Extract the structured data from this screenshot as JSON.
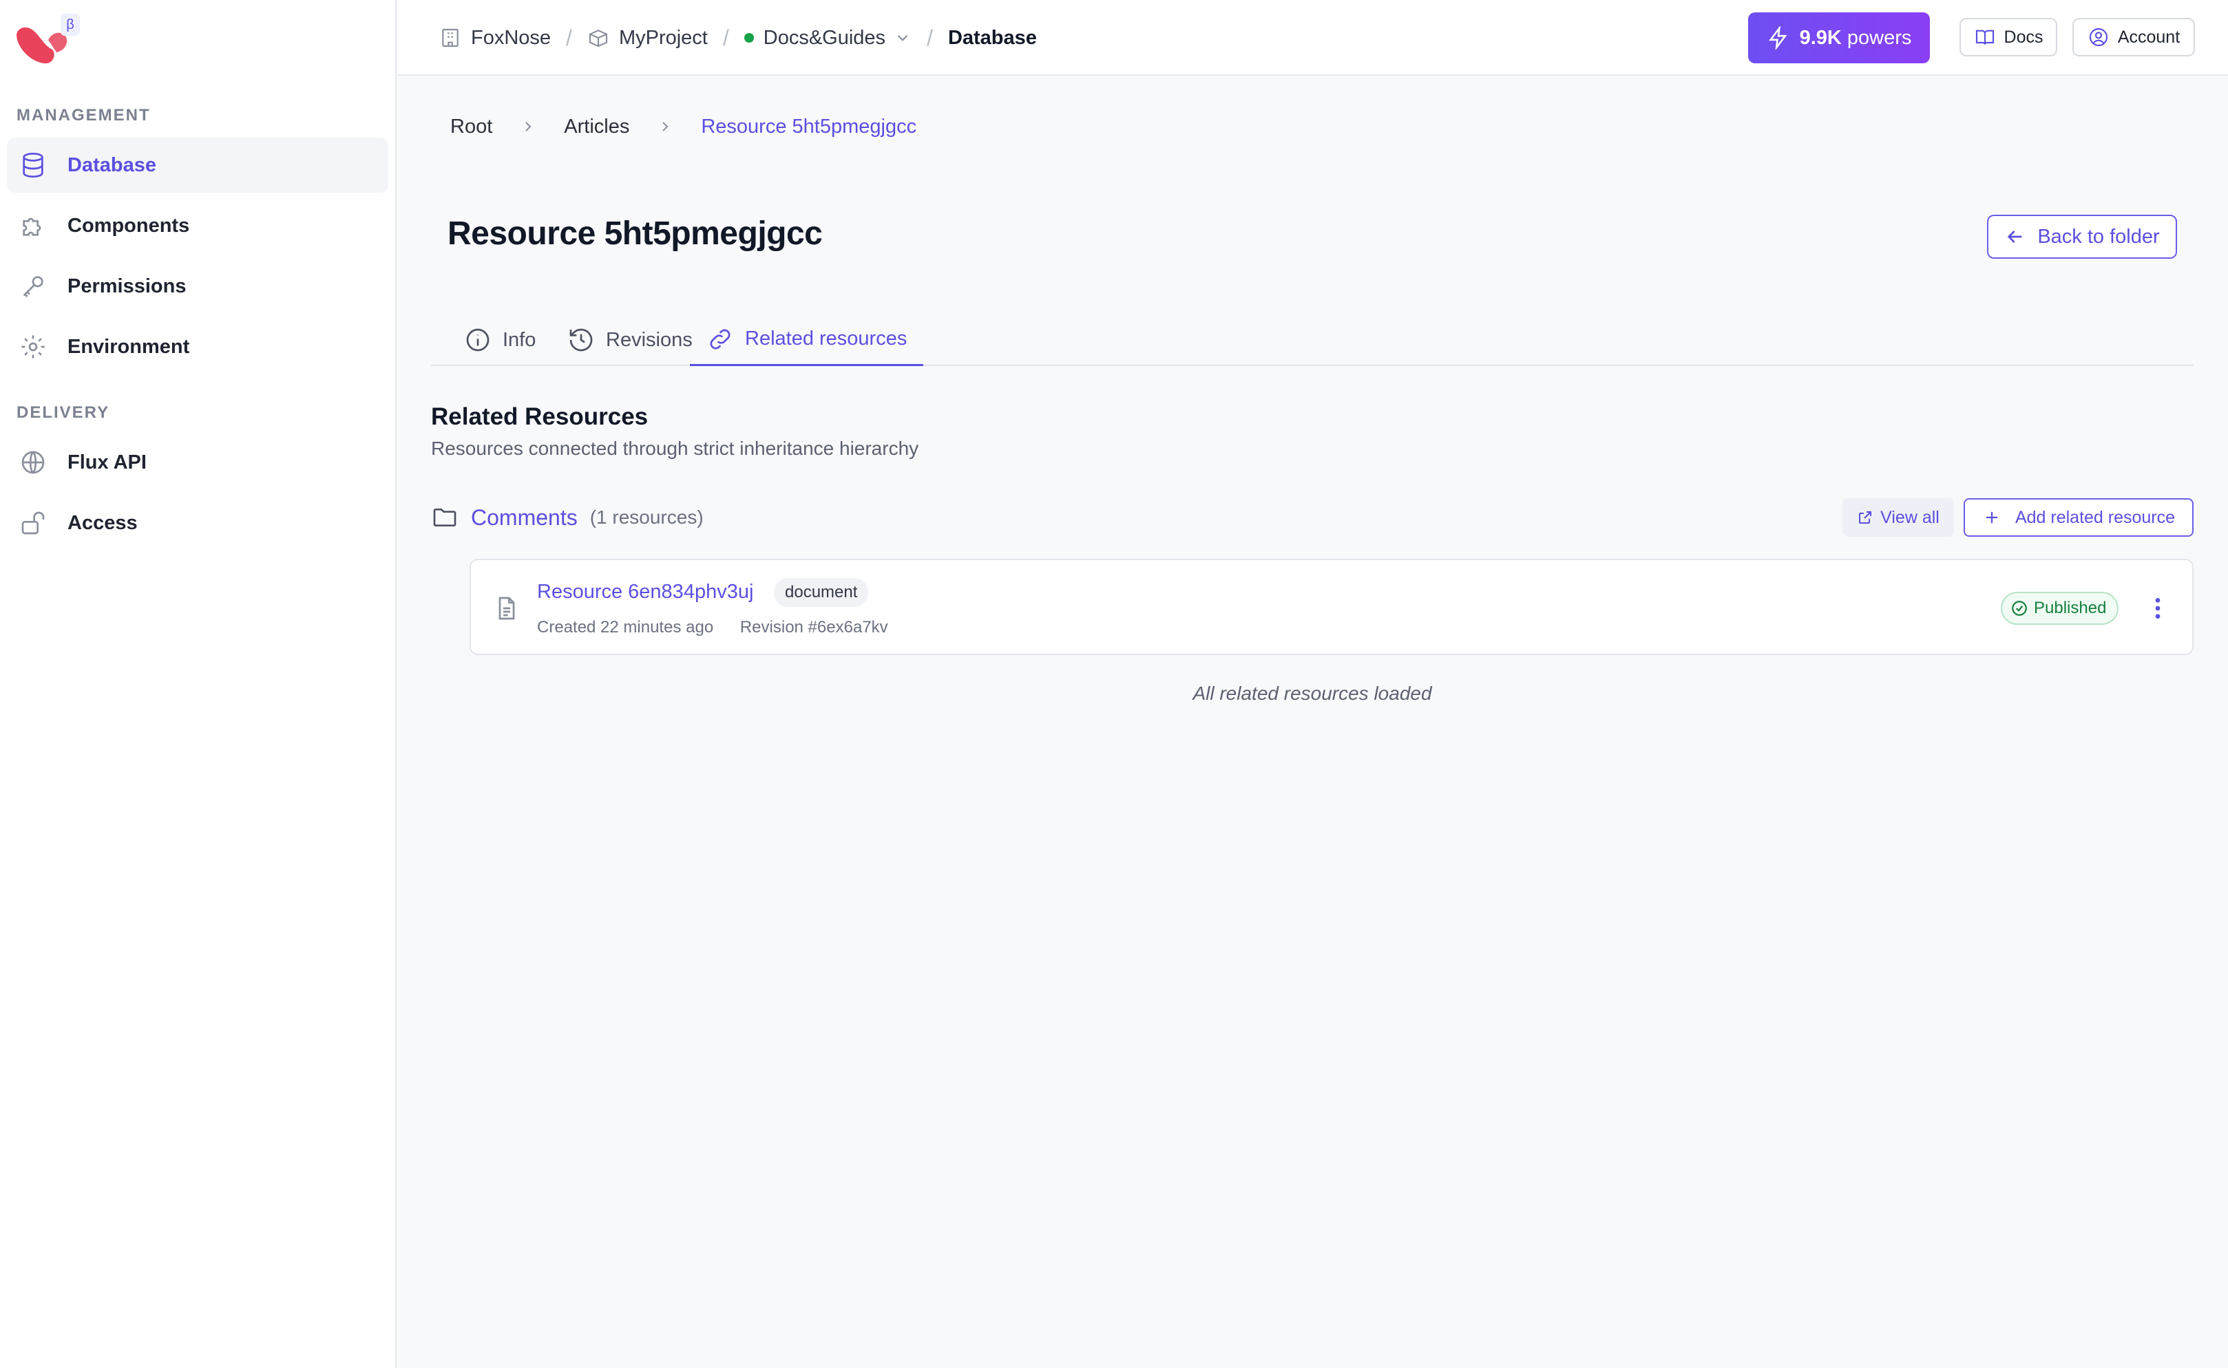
{
  "sidebar": {
    "beta_badge": "β",
    "sections": [
      {
        "label": "MANAGEMENT"
      },
      {
        "label": "DELIVERY"
      }
    ],
    "items": [
      {
        "label": "Database",
        "icon": "database-icon",
        "active": true
      },
      {
        "label": "Components",
        "icon": "puzzle-icon"
      },
      {
        "label": "Permissions",
        "icon": "key-icon"
      },
      {
        "label": "Environment",
        "icon": "gear-icon"
      },
      {
        "label": "Flux API",
        "icon": "globe-icon"
      },
      {
        "label": "Access",
        "icon": "unlock-icon"
      }
    ]
  },
  "topbar": {
    "breadcrumbs": [
      {
        "label": "FoxNose",
        "icon": "building-icon"
      },
      {
        "label": "MyProject",
        "icon": "box-icon"
      },
      {
        "label": "Docs&Guides",
        "status": "green-dot"
      },
      {
        "label": "Database"
      }
    ],
    "separator": "/",
    "powers": {
      "value": "9.9K",
      "label": "powers"
    },
    "docs_label": "Docs",
    "account_label": "Account"
  },
  "main": {
    "breadcrumbs": [
      "Root",
      "Articles",
      "Resource 5ht5pmegjgcc"
    ],
    "title": "Resource 5ht5pmegjgcc",
    "back_label": "Back to folder",
    "tabs": [
      {
        "label": "Info",
        "icon": "info-icon"
      },
      {
        "label": "Revisions",
        "icon": "history-icon"
      },
      {
        "label": "Related resources",
        "icon": "link-icon",
        "active": true
      }
    ],
    "section_title": "Related Resources",
    "section_subtitle": "Resources connected through strict inheritance hierarchy",
    "group": {
      "name": "Comments",
      "count": "(1 resources)",
      "view_all": "View all",
      "add_label": "Add related resource"
    },
    "resources": [
      {
        "name": "Resource 6en834phv3uj",
        "type": "document",
        "created": "Created 22 minutes ago",
        "revision": "Revision #6ex6a7kv",
        "status": "Published"
      }
    ],
    "footer_note": "All related resources loaded"
  },
  "colors": {
    "accent": "#5b4fe0",
    "published": "#15803d",
    "logo": "#e8435a"
  }
}
